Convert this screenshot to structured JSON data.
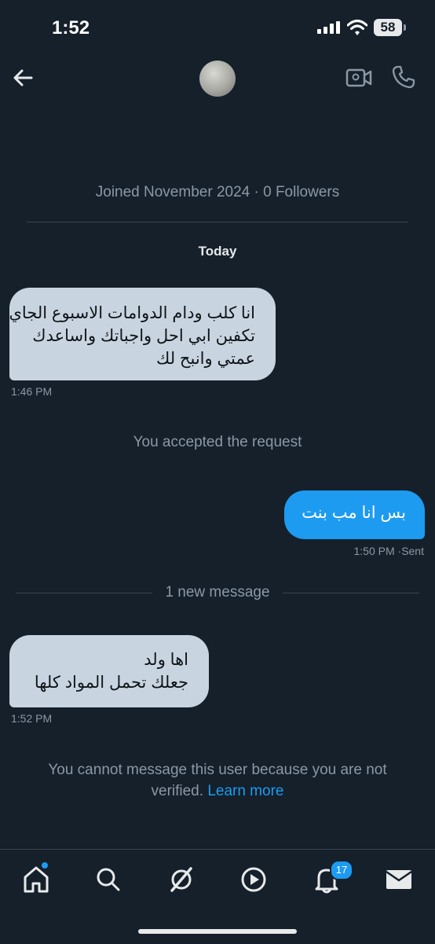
{
  "status_bar": {
    "time": "1:52",
    "battery": "58"
  },
  "header": {
    "avatar": "avatar",
    "back_icon": "back-arrow-icon",
    "video_icon": "video-call-icon",
    "phone_icon": "phone-call-icon"
  },
  "conversation": {
    "joined_text": "Joined November 2024 · 0 Followers",
    "date_divider": "Today",
    "messages": [
      {
        "direction": "incoming",
        "lines": [
          "انا كلب ودام الدوامات الاسبوع الجاي",
          "تكفين ابي احل واجباتك واساعدك",
          "عمتي وانبح لك"
        ],
        "time": "1:46 PM"
      },
      {
        "direction": "outgoing",
        "text": "بس انا مب بنت",
        "time": "1:50 PM",
        "status": "Sent"
      },
      {
        "direction": "incoming",
        "lines": [
          "اها ولد",
          "جعلك تحمل المواد كلها"
        ],
        "time": "1:52 PM"
      }
    ],
    "accepted_text": "You accepted the request",
    "new_message_divider": "1 new message",
    "restriction_text": "You cannot message this user because you are not verified.",
    "learn_more_link": "Learn more"
  },
  "tab_bar": {
    "items": [
      {
        "name": "home-icon",
        "has_dot": true
      },
      {
        "name": "search-icon"
      },
      {
        "name": "grok-icon"
      },
      {
        "name": "video-icon"
      },
      {
        "name": "notifications-icon",
        "badge": "17"
      },
      {
        "name": "messages-icon"
      }
    ]
  },
  "colors": {
    "background": "#15202b",
    "accent": "#1d9bf0",
    "incoming_bubble": "#c8d5e0",
    "secondary_text": "#8b98a5"
  }
}
